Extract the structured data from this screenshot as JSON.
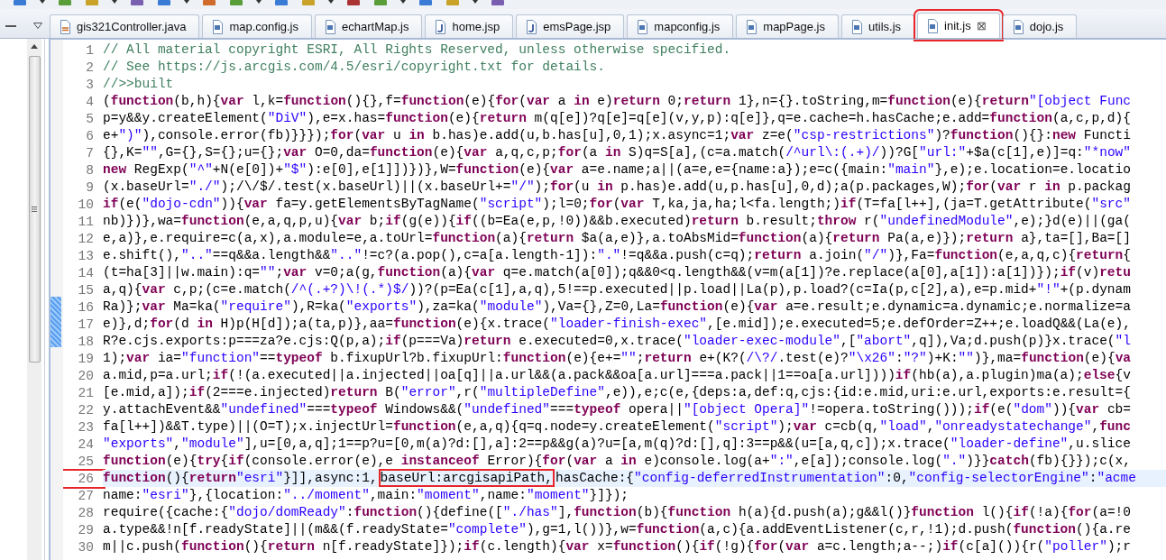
{
  "tabs": [
    {
      "label": "gis321Controller.java",
      "kind": "java",
      "selected": false,
      "annotated": false
    },
    {
      "label": "map.config.js",
      "kind": "js",
      "selected": false,
      "annotated": false
    },
    {
      "label": "echartMap.js",
      "kind": "js",
      "selected": false,
      "annotated": false
    },
    {
      "label": "home.jsp",
      "kind": "jsp",
      "selected": false,
      "annotated": false
    },
    {
      "label": "emsPage.jsp",
      "kind": "jsp",
      "selected": false,
      "annotated": false
    },
    {
      "label": "mapconfig.js",
      "kind": "js",
      "selected": false,
      "annotated": false
    },
    {
      "label": "mapPage.js",
      "kind": "js",
      "selected": false,
      "annotated": false
    },
    {
      "label": "utils.js",
      "kind": "js",
      "selected": false,
      "annotated": false
    },
    {
      "label": "init.js",
      "kind": "js",
      "selected": true,
      "annotated": true,
      "close": "⊠"
    },
    {
      "label": "dojo.js",
      "kind": "js",
      "selected": false,
      "annotated": false
    }
  ],
  "editor": {
    "lines": [
      {
        "number": "1",
        "current": false,
        "number_marked": false,
        "segments": [
          {
            "kind": "cm",
            "text": "// All material copyright ESRI, All Rights Reserved, unless otherwise specified."
          }
        ]
      },
      {
        "number": "2",
        "current": false,
        "number_marked": false,
        "segments": [
          {
            "kind": "cm",
            "text": "// See https://js.arcgis.com/4.5/esri/copyright.txt for details."
          }
        ]
      },
      {
        "number": "3",
        "current": false,
        "number_marked": false,
        "segments": [
          {
            "kind": "cm",
            "text": "//>>built"
          }
        ]
      },
      {
        "number": "4",
        "current": false,
        "number_marked": false,
        "segments": [
          {
            "kind": "txt",
            "text": "("
          },
          {
            "kind": "kw",
            "text": "function"
          },
          {
            "kind": "txt",
            "text": "(b,h){"
          },
          {
            "kind": "kw",
            "text": "var"
          },
          {
            "kind": "txt",
            "text": " l,k="
          },
          {
            "kind": "kw",
            "text": "function"
          },
          {
            "kind": "txt",
            "text": "(){},f="
          },
          {
            "kind": "kw",
            "text": "function"
          },
          {
            "kind": "txt",
            "text": "(e){"
          },
          {
            "kind": "kw",
            "text": "for"
          },
          {
            "kind": "txt",
            "text": "("
          },
          {
            "kind": "kw",
            "text": "var"
          },
          {
            "kind": "txt",
            "text": " a "
          },
          {
            "kind": "kw",
            "text": "in"
          },
          {
            "kind": "txt",
            "text": " e)"
          },
          {
            "kind": "kw",
            "text": "return"
          },
          {
            "kind": "txt",
            "text": " 0;"
          },
          {
            "kind": "kw",
            "text": "return"
          },
          {
            "kind": "txt",
            "text": " 1},n={}.toString,m="
          },
          {
            "kind": "kw",
            "text": "function"
          },
          {
            "kind": "txt",
            "text": "(e){"
          },
          {
            "kind": "kw",
            "text": "return"
          },
          {
            "kind": "str",
            "text": "\"[object Func"
          }
        ]
      },
      {
        "number": "5",
        "current": false,
        "number_marked": false,
        "segments": [
          {
            "kind": "txt",
            "text": "p=y&&y.createElement("
          },
          {
            "kind": "str",
            "text": "\"DiV\""
          },
          {
            "kind": "txt",
            "text": "),e=x.has="
          },
          {
            "kind": "kw",
            "text": "function"
          },
          {
            "kind": "txt",
            "text": "(e){"
          },
          {
            "kind": "kw",
            "text": "return"
          },
          {
            "kind": "txt",
            "text": " m(q[e])?q[e]=q[e](v,y,p):q[e]},q=e.cache=h.hasCache;e.add="
          },
          {
            "kind": "kw",
            "text": "function"
          },
          {
            "kind": "txt",
            "text": "(a,c,p,d){"
          }
        ]
      },
      {
        "number": "6",
        "current": false,
        "number_marked": false,
        "segments": [
          {
            "kind": "txt",
            "text": "e+"
          },
          {
            "kind": "str",
            "text": "\")\""
          },
          {
            "kind": "txt",
            "text": "),console.error(fb)}}});"
          },
          {
            "kind": "kw",
            "text": "for"
          },
          {
            "kind": "txt",
            "text": "("
          },
          {
            "kind": "kw",
            "text": "var"
          },
          {
            "kind": "txt",
            "text": " u "
          },
          {
            "kind": "kw",
            "text": "in"
          },
          {
            "kind": "txt",
            "text": " b.has)e.add(u,b.has[u],0,1);x.async=1;"
          },
          {
            "kind": "kw",
            "text": "var"
          },
          {
            "kind": "txt",
            "text": " z=e("
          },
          {
            "kind": "str",
            "text": "\"csp-restrictions\""
          },
          {
            "kind": "txt",
            "text": ")?"
          },
          {
            "kind": "kw",
            "text": "function"
          },
          {
            "kind": "txt",
            "text": "(){}:"
          },
          {
            "kind": "kw",
            "text": "new"
          },
          {
            "kind": "txt",
            "text": " Functi"
          }
        ]
      },
      {
        "number": "7",
        "current": false,
        "number_marked": false,
        "segments": [
          {
            "kind": "txt",
            "text": "{},K="
          },
          {
            "kind": "str",
            "text": "\"\""
          },
          {
            "kind": "txt",
            "text": ",G={},S={};u={};"
          },
          {
            "kind": "kw",
            "text": "var"
          },
          {
            "kind": "txt",
            "text": " O=0,da="
          },
          {
            "kind": "kw",
            "text": "function"
          },
          {
            "kind": "txt",
            "text": "(e){"
          },
          {
            "kind": "kw",
            "text": "var"
          },
          {
            "kind": "txt",
            "text": " a,q,c,p;"
          },
          {
            "kind": "kw",
            "text": "for"
          },
          {
            "kind": "txt",
            "text": "(a "
          },
          {
            "kind": "kw",
            "text": "in"
          },
          {
            "kind": "txt",
            "text": " S)q=S[a],(c=a.match("
          },
          {
            "kind": "str",
            "text": "/^url\\:(.+)/"
          },
          {
            "kind": "txt",
            "text": "))?G["
          },
          {
            "kind": "str",
            "text": "\"url:\""
          },
          {
            "kind": "txt",
            "text": "+$a(c[1],e)]=q:"
          },
          {
            "kind": "str",
            "text": "\"*now\""
          }
        ]
      },
      {
        "number": "8",
        "current": false,
        "number_marked": false,
        "segments": [
          {
            "kind": "kw",
            "text": "new"
          },
          {
            "kind": "txt",
            "text": " RegExp("
          },
          {
            "kind": "str",
            "text": "\"^\""
          },
          {
            "kind": "txt",
            "text": "+N(e[0])+"
          },
          {
            "kind": "str",
            "text": "\"$\""
          },
          {
            "kind": "txt",
            "text": "):e[0],e[1]])})},W="
          },
          {
            "kind": "kw",
            "text": "function"
          },
          {
            "kind": "txt",
            "text": "(e){"
          },
          {
            "kind": "kw",
            "text": "var"
          },
          {
            "kind": "txt",
            "text": " a=e.name;a||(a=e,e={name:a});e=c({main:"
          },
          {
            "kind": "str",
            "text": "\"main\""
          },
          {
            "kind": "txt",
            "text": "},e);e.location=e.locatio"
          }
        ]
      },
      {
        "number": "9",
        "current": false,
        "number_marked": false,
        "segments": [
          {
            "kind": "txt",
            "text": "(x.baseUrl="
          },
          {
            "kind": "str",
            "text": "\"./\""
          },
          {
            "kind": "txt",
            "text": ");/\\/$/.test(x.baseUrl)||(x.baseUrl+="
          },
          {
            "kind": "str",
            "text": "\"/\""
          },
          {
            "kind": "txt",
            "text": ");"
          },
          {
            "kind": "kw",
            "text": "for"
          },
          {
            "kind": "txt",
            "text": "(u "
          },
          {
            "kind": "kw",
            "text": "in"
          },
          {
            "kind": "txt",
            "text": " p.has)e.add(u,p.has[u],0,d);a(p.packages,W);"
          },
          {
            "kind": "kw",
            "text": "for"
          },
          {
            "kind": "txt",
            "text": "("
          },
          {
            "kind": "kw",
            "text": "var"
          },
          {
            "kind": "txt",
            "text": " r "
          },
          {
            "kind": "kw",
            "text": "in"
          },
          {
            "kind": "txt",
            "text": " p.packag"
          }
        ]
      },
      {
        "number": "10",
        "current": false,
        "number_marked": false,
        "segments": [
          {
            "kind": "kw",
            "text": "if"
          },
          {
            "kind": "txt",
            "text": "(e("
          },
          {
            "kind": "str",
            "text": "\"dojo-cdn\""
          },
          {
            "kind": "txt",
            "text": ")){"
          },
          {
            "kind": "kw",
            "text": "var"
          },
          {
            "kind": "txt",
            "text": " fa=y.getElementsByTagName("
          },
          {
            "kind": "str",
            "text": "\"script\""
          },
          {
            "kind": "txt",
            "text": ");l=0;"
          },
          {
            "kind": "kw",
            "text": "for"
          },
          {
            "kind": "txt",
            "text": "("
          },
          {
            "kind": "kw",
            "text": "var"
          },
          {
            "kind": "txt",
            "text": " T,ka,ja,ha;l<fa.length;)"
          },
          {
            "kind": "kw",
            "text": "if"
          },
          {
            "kind": "txt",
            "text": "(T=fa[l++],(ja=T.getAttribute("
          },
          {
            "kind": "str",
            "text": "\"src\""
          }
        ]
      },
      {
        "number": "11",
        "current": false,
        "number_marked": false,
        "segments": [
          {
            "kind": "txt",
            "text": "nb)})},wa="
          },
          {
            "kind": "kw",
            "text": "function"
          },
          {
            "kind": "txt",
            "text": "(e,a,q,p,u){"
          },
          {
            "kind": "kw",
            "text": "var"
          },
          {
            "kind": "txt",
            "text": " b;"
          },
          {
            "kind": "kw",
            "text": "if"
          },
          {
            "kind": "txt",
            "text": "(g(e)){"
          },
          {
            "kind": "kw",
            "text": "if"
          },
          {
            "kind": "txt",
            "text": "((b=Ea(e,p,!0))&&b.executed)"
          },
          {
            "kind": "kw",
            "text": "return"
          },
          {
            "kind": "txt",
            "text": " b.result;"
          },
          {
            "kind": "kw",
            "text": "throw"
          },
          {
            "kind": "txt",
            "text": " r("
          },
          {
            "kind": "str",
            "text": "\"undefinedModule\""
          },
          {
            "kind": "txt",
            "text": ",e);}d(e)||(ga("
          }
        ]
      },
      {
        "number": "12",
        "current": false,
        "number_marked": false,
        "segments": [
          {
            "kind": "txt",
            "text": "e,a)},e.require=c(a,x),a.module=e,a.toUrl="
          },
          {
            "kind": "kw",
            "text": "function"
          },
          {
            "kind": "txt",
            "text": "(a){"
          },
          {
            "kind": "kw",
            "text": "return"
          },
          {
            "kind": "txt",
            "text": " $a(a,e)},a.toAbsMid="
          },
          {
            "kind": "kw",
            "text": "function"
          },
          {
            "kind": "txt",
            "text": "(a){"
          },
          {
            "kind": "kw",
            "text": "return"
          },
          {
            "kind": "txt",
            "text": " Pa(a,e)});"
          },
          {
            "kind": "kw",
            "text": "return"
          },
          {
            "kind": "txt",
            "text": " a},ta=[],Ba=[]"
          }
        ]
      },
      {
        "number": "13",
        "current": false,
        "number_marked": false,
        "segments": [
          {
            "kind": "txt",
            "text": "e.shift(),"
          },
          {
            "kind": "str",
            "text": "\"..\""
          },
          {
            "kind": "txt",
            "text": "==q&&a.length&&"
          },
          {
            "kind": "str",
            "text": "\"..\""
          },
          {
            "kind": "txt",
            "text": "!=c?(a.pop(),c=a[a.length-1]):"
          },
          {
            "kind": "str",
            "text": "\".\""
          },
          {
            "kind": "txt",
            "text": "!=q&&a.push(c=q);"
          },
          {
            "kind": "kw",
            "text": "return"
          },
          {
            "kind": "txt",
            "text": " a.join("
          },
          {
            "kind": "str",
            "text": "\"/\""
          },
          {
            "kind": "txt",
            "text": ")},Fa="
          },
          {
            "kind": "kw",
            "text": "function"
          },
          {
            "kind": "txt",
            "text": "(e,a,q,c){"
          },
          {
            "kind": "kw",
            "text": "return"
          },
          {
            "kind": "txt",
            "text": "{"
          }
        ]
      },
      {
        "number": "14",
        "current": false,
        "number_marked": false,
        "segments": [
          {
            "kind": "txt",
            "text": "(t=ha[3]||w.main):q="
          },
          {
            "kind": "str",
            "text": "\"\""
          },
          {
            "kind": "txt",
            "text": ";"
          },
          {
            "kind": "kw",
            "text": "var"
          },
          {
            "kind": "txt",
            "text": " v=0;a(g,"
          },
          {
            "kind": "kw",
            "text": "function"
          },
          {
            "kind": "txt",
            "text": "(a){"
          },
          {
            "kind": "kw",
            "text": "var"
          },
          {
            "kind": "txt",
            "text": " q=e.match(a[0]);q&&0<q.length&&(v=m(a[1])?e.replace(a[0],a[1]):a[1])});"
          },
          {
            "kind": "kw",
            "text": "if"
          },
          {
            "kind": "txt",
            "text": "(v)"
          },
          {
            "kind": "kw",
            "text": "retu"
          }
        ]
      },
      {
        "number": "15",
        "current": false,
        "number_marked": false,
        "segments": [
          {
            "kind": "txt",
            "text": "a,q){"
          },
          {
            "kind": "kw",
            "text": "var"
          },
          {
            "kind": "txt",
            "text": " c,p;(c=e.match("
          },
          {
            "kind": "str",
            "text": "/^(.+?)\\!(.*)$/"
          },
          {
            "kind": "txt",
            "text": "))?(p=Ea(c[1],a,q),5!==p.executed||p.load||La(p),p.load?(c=Ia(p,c[2],a),e=p.mid+"
          },
          {
            "kind": "str",
            "text": "\"!\""
          },
          {
            "kind": "txt",
            "text": "+(p.dynam"
          }
        ]
      },
      {
        "number": "16",
        "current": false,
        "number_marked": false,
        "segments": [
          {
            "kind": "txt",
            "text": "Ra)};"
          },
          {
            "kind": "kw",
            "text": "var"
          },
          {
            "kind": "txt",
            "text": " Ma=ka("
          },
          {
            "kind": "str",
            "text": "\"require\""
          },
          {
            "kind": "txt",
            "text": "),R=ka("
          },
          {
            "kind": "str",
            "text": "\"exports\""
          },
          {
            "kind": "txt",
            "text": "),za=ka("
          },
          {
            "kind": "str",
            "text": "\"module\""
          },
          {
            "kind": "txt",
            "text": "),Va={},Z=0,La="
          },
          {
            "kind": "kw",
            "text": "function"
          },
          {
            "kind": "txt",
            "text": "(e){"
          },
          {
            "kind": "kw",
            "text": "var"
          },
          {
            "kind": "txt",
            "text": " a=e.result;e.dynamic=a.dynamic;e.normalize=a"
          }
        ]
      },
      {
        "number": "17",
        "current": false,
        "number_marked": false,
        "segments": [
          {
            "kind": "txt",
            "text": "e)},d;"
          },
          {
            "kind": "kw",
            "text": "for"
          },
          {
            "kind": "txt",
            "text": "(d "
          },
          {
            "kind": "kw",
            "text": "in"
          },
          {
            "kind": "txt",
            "text": " H)p(H[d]);a(ta,p)},aa="
          },
          {
            "kind": "kw",
            "text": "function"
          },
          {
            "kind": "txt",
            "text": "(e){x.trace("
          },
          {
            "kind": "str",
            "text": "\"loader-finish-exec\""
          },
          {
            "kind": "txt",
            "text": ",[e.mid]);e.executed=5;e.defOrder=Z++;e.loadQ&&(La(e),"
          }
        ]
      },
      {
        "number": "18",
        "current": false,
        "number_marked": false,
        "segments": [
          {
            "kind": "txt",
            "text": "R?e.cjs.exports:p===za?e.cjs:Q(p,a);"
          },
          {
            "kind": "kw",
            "text": "if"
          },
          {
            "kind": "txt",
            "text": "(p===Va)"
          },
          {
            "kind": "kw",
            "text": "return"
          },
          {
            "kind": "txt",
            "text": " e.executed=0,x.trace("
          },
          {
            "kind": "str",
            "text": "\"loader-exec-module\""
          },
          {
            "kind": "txt",
            "text": ",["
          },
          {
            "kind": "str",
            "text": "\"abort\""
          },
          {
            "kind": "txt",
            "text": ",q]),Va;d.push(p)}x.trace("
          },
          {
            "kind": "str",
            "text": "\"l"
          }
        ]
      },
      {
        "number": "19",
        "current": false,
        "number_marked": false,
        "segments": [
          {
            "kind": "txt",
            "text": "1);"
          },
          {
            "kind": "kw",
            "text": "var"
          },
          {
            "kind": "txt",
            "text": " ia="
          },
          {
            "kind": "str",
            "text": "\"function\""
          },
          {
            "kind": "txt",
            "text": "=="
          },
          {
            "kind": "kw",
            "text": "typeof"
          },
          {
            "kind": "txt",
            "text": " b.fixupUrl?b.fixupUrl:"
          },
          {
            "kind": "kw",
            "text": "function"
          },
          {
            "kind": "txt",
            "text": "(e){e+="
          },
          {
            "kind": "str",
            "text": "\"\""
          },
          {
            "kind": "txt",
            "text": ";"
          },
          {
            "kind": "kw",
            "text": "return"
          },
          {
            "kind": "txt",
            "text": " e+(K?("
          },
          {
            "kind": "str",
            "text": "/\\?/"
          },
          {
            "kind": "txt",
            "text": ".test(e)?"
          },
          {
            "kind": "str",
            "text": "\"\\x26\""
          },
          {
            "kind": "txt",
            "text": ":"
          },
          {
            "kind": "str",
            "text": "\"?\""
          },
          {
            "kind": "txt",
            "text": ")+K:"
          },
          {
            "kind": "str",
            "text": "\"\""
          },
          {
            "kind": "txt",
            "text": ")},ma="
          },
          {
            "kind": "kw",
            "text": "function"
          },
          {
            "kind": "txt",
            "text": "(e){"
          },
          {
            "kind": "kw",
            "text": "va"
          }
        ]
      },
      {
        "number": "20",
        "current": false,
        "number_marked": false,
        "segments": [
          {
            "kind": "txt",
            "text": "a.mid,p=a.url;"
          },
          {
            "kind": "kw",
            "text": "if"
          },
          {
            "kind": "txt",
            "text": "(!(a.executed||a.injected||oa[q]||a.url&&(a.pack&&oa[a.url]===a.pack||1==oa[a.url])))"
          },
          {
            "kind": "kw",
            "text": "if"
          },
          {
            "kind": "txt",
            "text": "(hb(a),a.plugin)ma(a);"
          },
          {
            "kind": "kw",
            "text": "else"
          },
          {
            "kind": "txt",
            "text": "{v"
          }
        ]
      },
      {
        "number": "21",
        "current": false,
        "number_marked": false,
        "segments": [
          {
            "kind": "txt",
            "text": "[e.mid,a]);"
          },
          {
            "kind": "kw",
            "text": "if"
          },
          {
            "kind": "txt",
            "text": "(2===e.injected)"
          },
          {
            "kind": "kw",
            "text": "return"
          },
          {
            "kind": "txt",
            "text": " B("
          },
          {
            "kind": "str",
            "text": "\"error\""
          },
          {
            "kind": "txt",
            "text": ",r("
          },
          {
            "kind": "str",
            "text": "\"multipleDefine\""
          },
          {
            "kind": "txt",
            "text": ",e)),e;c(e,{deps:a,def:q,cjs:{id:e.mid,uri:e.url,exports:e.result={"
          }
        ]
      },
      {
        "number": "22",
        "current": false,
        "number_marked": false,
        "segments": [
          {
            "kind": "txt",
            "text": "y.attachEvent&&"
          },
          {
            "kind": "str",
            "text": "\"undefined\""
          },
          {
            "kind": "txt",
            "text": "==="
          },
          {
            "kind": "kw",
            "text": "typeof"
          },
          {
            "kind": "txt",
            "text": " Windows&&("
          },
          {
            "kind": "str",
            "text": "\"undefined\""
          },
          {
            "kind": "txt",
            "text": "==="
          },
          {
            "kind": "kw",
            "text": "typeof"
          },
          {
            "kind": "txt",
            "text": " opera||"
          },
          {
            "kind": "str",
            "text": "\"[object Opera]\""
          },
          {
            "kind": "txt",
            "text": "!=opera.toString()));"
          },
          {
            "kind": "kw",
            "text": "if"
          },
          {
            "kind": "txt",
            "text": "(e("
          },
          {
            "kind": "str",
            "text": "\"dom\""
          },
          {
            "kind": "txt",
            "text": ")){"
          },
          {
            "kind": "kw",
            "text": "var"
          },
          {
            "kind": "txt",
            "text": " cb="
          }
        ]
      },
      {
        "number": "23",
        "current": false,
        "number_marked": false,
        "segments": [
          {
            "kind": "txt",
            "text": "fa[l++])&&T.type)||(O=T);x.injectUrl="
          },
          {
            "kind": "kw",
            "text": "function"
          },
          {
            "kind": "txt",
            "text": "(e,a,q){q=q.node=y.createElement("
          },
          {
            "kind": "str",
            "text": "\"script\""
          },
          {
            "kind": "txt",
            "text": ");"
          },
          {
            "kind": "kw",
            "text": "var"
          },
          {
            "kind": "txt",
            "text": " c=cb(q,"
          },
          {
            "kind": "str",
            "text": "\"load\""
          },
          {
            "kind": "txt",
            "text": ","
          },
          {
            "kind": "str",
            "text": "\"onreadystatechange\""
          },
          {
            "kind": "txt",
            "text": ","
          },
          {
            "kind": "kw",
            "text": "func"
          }
        ]
      },
      {
        "number": "24",
        "current": false,
        "number_marked": false,
        "segments": [
          {
            "kind": "str",
            "text": "\"exports\""
          },
          {
            "kind": "txt",
            "text": ","
          },
          {
            "kind": "str",
            "text": "\"module\""
          },
          {
            "kind": "txt",
            "text": "],u=[0,a,q];1==p?u=[0,m(a)?d:[],a]:2==p&&g(a)?u=[a,m(q)?d:[],q]:3==p&&(u=[a,q,c]);x.trace("
          },
          {
            "kind": "str",
            "text": "\"loader-define\""
          },
          {
            "kind": "txt",
            "text": ",u.slice"
          }
        ]
      },
      {
        "number": "25",
        "current": false,
        "number_marked": false,
        "segments": [
          {
            "kind": "kw",
            "text": "function"
          },
          {
            "kind": "txt",
            "text": "(e){"
          },
          {
            "kind": "kw",
            "text": "try"
          },
          {
            "kind": "txt",
            "text": "{"
          },
          {
            "kind": "kw",
            "text": "if"
          },
          {
            "kind": "txt",
            "text": "(console.error(e),e "
          },
          {
            "kind": "kw",
            "text": "instanceof"
          },
          {
            "kind": "txt",
            "text": " Error){"
          },
          {
            "kind": "kw",
            "text": "for"
          },
          {
            "kind": "txt",
            "text": "("
          },
          {
            "kind": "kw",
            "text": "var"
          },
          {
            "kind": "txt",
            "text": " a "
          },
          {
            "kind": "kw",
            "text": "in"
          },
          {
            "kind": "txt",
            "text": " e)console.log(a+"
          },
          {
            "kind": "str",
            "text": "\":\""
          },
          {
            "kind": "txt",
            "text": ",e[a]);console.log("
          },
          {
            "kind": "str",
            "text": "\".\""
          },
          {
            "kind": "txt",
            "text": ")}}"
          },
          {
            "kind": "kw",
            "text": "catch"
          },
          {
            "kind": "txt",
            "text": "(fb){}});c(x,"
          }
        ]
      },
      {
        "number": "26",
        "current": true,
        "number_marked": true,
        "segments": [
          {
            "kind": "kw",
            "text": "function"
          },
          {
            "kind": "txt",
            "text": "(){"
          },
          {
            "kind": "kw",
            "text": "return"
          },
          {
            "kind": "str",
            "text": "\"esri\""
          },
          {
            "kind": "txt",
            "text": "}]],async:1,"
          },
          {
            "kind": "box",
            "text": "baseUrl:arcgisapiPath,"
          },
          {
            "kind": "txt",
            "text": "hasCache:{"
          },
          {
            "kind": "str",
            "text": "\"config-deferredInstrumentation\""
          },
          {
            "kind": "txt",
            "text": ":0,"
          },
          {
            "kind": "str",
            "text": "\"config-selectorEngine\""
          },
          {
            "kind": "txt",
            "text": ":"
          },
          {
            "kind": "str",
            "text": "\"acme"
          }
        ]
      },
      {
        "number": "27",
        "current": false,
        "number_marked": false,
        "segments": [
          {
            "kind": "txt",
            "text": "name:"
          },
          {
            "kind": "str",
            "text": "\"esri\""
          },
          {
            "kind": "txt",
            "text": "},{location:"
          },
          {
            "kind": "str",
            "text": "\"../moment\""
          },
          {
            "kind": "txt",
            "text": ",main:"
          },
          {
            "kind": "str",
            "text": "\"moment\""
          },
          {
            "kind": "txt",
            "text": ",name:"
          },
          {
            "kind": "str",
            "text": "\"moment\""
          },
          {
            "kind": "txt",
            "text": "}]});"
          }
        ]
      },
      {
        "number": "28",
        "current": false,
        "number_marked": false,
        "segments": [
          {
            "kind": "txt",
            "text": "require({cache:{"
          },
          {
            "kind": "str",
            "text": "\"dojo/domReady\""
          },
          {
            "kind": "txt",
            "text": ":"
          },
          {
            "kind": "kw",
            "text": "function"
          },
          {
            "kind": "txt",
            "text": "(){define(["
          },
          {
            "kind": "str",
            "text": "\"./has\""
          },
          {
            "kind": "txt",
            "text": "],"
          },
          {
            "kind": "kw",
            "text": "function"
          },
          {
            "kind": "txt",
            "text": "(b){"
          },
          {
            "kind": "kw",
            "text": "function"
          },
          {
            "kind": "txt",
            "text": " h(a){d.push(a);g&&l()}"
          },
          {
            "kind": "kw",
            "text": "function"
          },
          {
            "kind": "txt",
            "text": " l(){"
          },
          {
            "kind": "kw",
            "text": "if"
          },
          {
            "kind": "txt",
            "text": "(!a){"
          },
          {
            "kind": "kw",
            "text": "for"
          },
          {
            "kind": "txt",
            "text": "(a=!0"
          }
        ]
      },
      {
        "number": "29",
        "current": false,
        "number_marked": false,
        "segments": [
          {
            "kind": "txt",
            "text": "a.type&&!n[f.readyState]||(m&&(f.readyState="
          },
          {
            "kind": "str",
            "text": "\"complete\""
          },
          {
            "kind": "txt",
            "text": "),g=1,l())},w="
          },
          {
            "kind": "kw",
            "text": "function"
          },
          {
            "kind": "txt",
            "text": "(a,c){a.addEventListener(c,r,!1);d.push("
          },
          {
            "kind": "kw",
            "text": "function"
          },
          {
            "kind": "txt",
            "text": "(){a.re"
          }
        ]
      },
      {
        "number": "30",
        "current": false,
        "number_marked": false,
        "segments": [
          {
            "kind": "txt",
            "text": "m||c.push("
          },
          {
            "kind": "kw",
            "text": "function"
          },
          {
            "kind": "txt",
            "text": "(){"
          },
          {
            "kind": "kw",
            "text": "return"
          },
          {
            "kind": "txt",
            "text": " n[f.readyState]});"
          },
          {
            "kind": "kw",
            "text": "if"
          },
          {
            "kind": "txt",
            "text": "(c.length){"
          },
          {
            "kind": "kw",
            "text": "var"
          },
          {
            "kind": "txt",
            "text": " x="
          },
          {
            "kind": "kw",
            "text": "function"
          },
          {
            "kind": "txt",
            "text": "(){"
          },
          {
            "kind": "kw",
            "text": "if"
          },
          {
            "kind": "txt",
            "text": "(!g){"
          },
          {
            "kind": "kw",
            "text": "for"
          },
          {
            "kind": "txt",
            "text": "("
          },
          {
            "kind": "kw",
            "text": "var"
          },
          {
            "kind": "txt",
            "text": " a=c.length;a--;)"
          },
          {
            "kind": "kw",
            "text": "if"
          },
          {
            "kind": "txt",
            "text": "(c[a]()){r("
          },
          {
            "kind": "str",
            "text": "\"poller\""
          },
          {
            "kind": "txt",
            "text": ");r"
          }
        ]
      }
    ]
  }
}
